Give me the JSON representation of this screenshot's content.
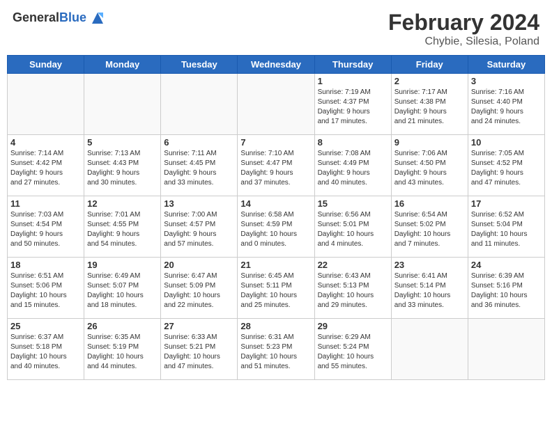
{
  "header": {
    "logo_general": "General",
    "logo_blue": "Blue",
    "month_year": "February 2024",
    "location": "Chybie, Silesia, Poland"
  },
  "weekdays": [
    "Sunday",
    "Monday",
    "Tuesday",
    "Wednesday",
    "Thursday",
    "Friday",
    "Saturday"
  ],
  "weeks": [
    [
      {
        "day": "",
        "detail": ""
      },
      {
        "day": "",
        "detail": ""
      },
      {
        "day": "",
        "detail": ""
      },
      {
        "day": "",
        "detail": ""
      },
      {
        "day": "1",
        "detail": "Sunrise: 7:19 AM\nSunset: 4:37 PM\nDaylight: 9 hours\nand 17 minutes."
      },
      {
        "day": "2",
        "detail": "Sunrise: 7:17 AM\nSunset: 4:38 PM\nDaylight: 9 hours\nand 21 minutes."
      },
      {
        "day": "3",
        "detail": "Sunrise: 7:16 AM\nSunset: 4:40 PM\nDaylight: 9 hours\nand 24 minutes."
      }
    ],
    [
      {
        "day": "4",
        "detail": "Sunrise: 7:14 AM\nSunset: 4:42 PM\nDaylight: 9 hours\nand 27 minutes."
      },
      {
        "day": "5",
        "detail": "Sunrise: 7:13 AM\nSunset: 4:43 PM\nDaylight: 9 hours\nand 30 minutes."
      },
      {
        "day": "6",
        "detail": "Sunrise: 7:11 AM\nSunset: 4:45 PM\nDaylight: 9 hours\nand 33 minutes."
      },
      {
        "day": "7",
        "detail": "Sunrise: 7:10 AM\nSunset: 4:47 PM\nDaylight: 9 hours\nand 37 minutes."
      },
      {
        "day": "8",
        "detail": "Sunrise: 7:08 AM\nSunset: 4:49 PM\nDaylight: 9 hours\nand 40 minutes."
      },
      {
        "day": "9",
        "detail": "Sunrise: 7:06 AM\nSunset: 4:50 PM\nDaylight: 9 hours\nand 43 minutes."
      },
      {
        "day": "10",
        "detail": "Sunrise: 7:05 AM\nSunset: 4:52 PM\nDaylight: 9 hours\nand 47 minutes."
      }
    ],
    [
      {
        "day": "11",
        "detail": "Sunrise: 7:03 AM\nSunset: 4:54 PM\nDaylight: 9 hours\nand 50 minutes."
      },
      {
        "day": "12",
        "detail": "Sunrise: 7:01 AM\nSunset: 4:55 PM\nDaylight: 9 hours\nand 54 minutes."
      },
      {
        "day": "13",
        "detail": "Sunrise: 7:00 AM\nSunset: 4:57 PM\nDaylight: 9 hours\nand 57 minutes."
      },
      {
        "day": "14",
        "detail": "Sunrise: 6:58 AM\nSunset: 4:59 PM\nDaylight: 10 hours\nand 0 minutes."
      },
      {
        "day": "15",
        "detail": "Sunrise: 6:56 AM\nSunset: 5:01 PM\nDaylight: 10 hours\nand 4 minutes."
      },
      {
        "day": "16",
        "detail": "Sunrise: 6:54 AM\nSunset: 5:02 PM\nDaylight: 10 hours\nand 7 minutes."
      },
      {
        "day": "17",
        "detail": "Sunrise: 6:52 AM\nSunset: 5:04 PM\nDaylight: 10 hours\nand 11 minutes."
      }
    ],
    [
      {
        "day": "18",
        "detail": "Sunrise: 6:51 AM\nSunset: 5:06 PM\nDaylight: 10 hours\nand 15 minutes."
      },
      {
        "day": "19",
        "detail": "Sunrise: 6:49 AM\nSunset: 5:07 PM\nDaylight: 10 hours\nand 18 minutes."
      },
      {
        "day": "20",
        "detail": "Sunrise: 6:47 AM\nSunset: 5:09 PM\nDaylight: 10 hours\nand 22 minutes."
      },
      {
        "day": "21",
        "detail": "Sunrise: 6:45 AM\nSunset: 5:11 PM\nDaylight: 10 hours\nand 25 minutes."
      },
      {
        "day": "22",
        "detail": "Sunrise: 6:43 AM\nSunset: 5:13 PM\nDaylight: 10 hours\nand 29 minutes."
      },
      {
        "day": "23",
        "detail": "Sunrise: 6:41 AM\nSunset: 5:14 PM\nDaylight: 10 hours\nand 33 minutes."
      },
      {
        "day": "24",
        "detail": "Sunrise: 6:39 AM\nSunset: 5:16 PM\nDaylight: 10 hours\nand 36 minutes."
      }
    ],
    [
      {
        "day": "25",
        "detail": "Sunrise: 6:37 AM\nSunset: 5:18 PM\nDaylight: 10 hours\nand 40 minutes."
      },
      {
        "day": "26",
        "detail": "Sunrise: 6:35 AM\nSunset: 5:19 PM\nDaylight: 10 hours\nand 44 minutes."
      },
      {
        "day": "27",
        "detail": "Sunrise: 6:33 AM\nSunset: 5:21 PM\nDaylight: 10 hours\nand 47 minutes."
      },
      {
        "day": "28",
        "detail": "Sunrise: 6:31 AM\nSunset: 5:23 PM\nDaylight: 10 hours\nand 51 minutes."
      },
      {
        "day": "29",
        "detail": "Sunrise: 6:29 AM\nSunset: 5:24 PM\nDaylight: 10 hours\nand 55 minutes."
      },
      {
        "day": "",
        "detail": ""
      },
      {
        "day": "",
        "detail": ""
      }
    ]
  ]
}
